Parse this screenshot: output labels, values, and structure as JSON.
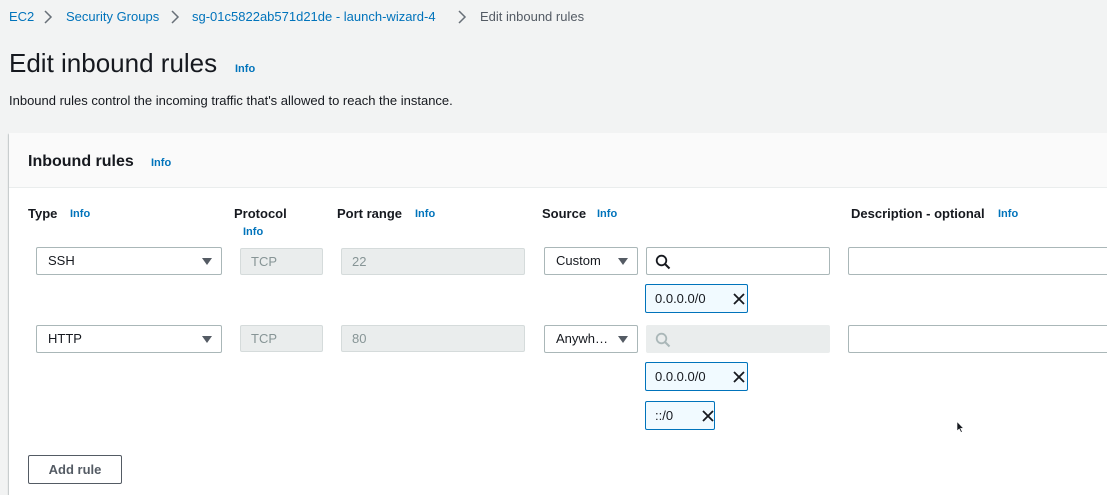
{
  "breadcrumb": {
    "items": [
      "EC2",
      "Security Groups",
      "sg-01c5822ab571d21de - launch-wizard-4"
    ],
    "current": "Edit inbound rules"
  },
  "page": {
    "title": "Edit inbound rules",
    "info": "Info",
    "description": "Inbound rules control the incoming traffic that's allowed to reach the instance."
  },
  "panel": {
    "title": "Inbound rules",
    "info": "Info"
  },
  "columns": {
    "type": "Type",
    "protocol": "Protocol",
    "port_range": "Port range",
    "source": "Source",
    "description": "Description - optional",
    "info": "Info"
  },
  "rules": [
    {
      "type": "SSH",
      "protocol": "TCP",
      "port_range": "22",
      "source_mode": "Custom",
      "search_value": "",
      "cidrs": [
        "0.0.0.0/0"
      ],
      "description": ""
    },
    {
      "type": "HTTP",
      "protocol": "TCP",
      "port_range": "80",
      "source_mode": "Anywh…",
      "search_value": "",
      "cidrs": [
        "0.0.0.0/0",
        "::/0"
      ],
      "description": ""
    }
  ],
  "actions": {
    "add_rule": "Add rule"
  },
  "colors": {
    "link": "#0073bb",
    "token_bg": "#f1faff",
    "token_border": "#0073bb",
    "disabled_bg": "#eaeded"
  }
}
